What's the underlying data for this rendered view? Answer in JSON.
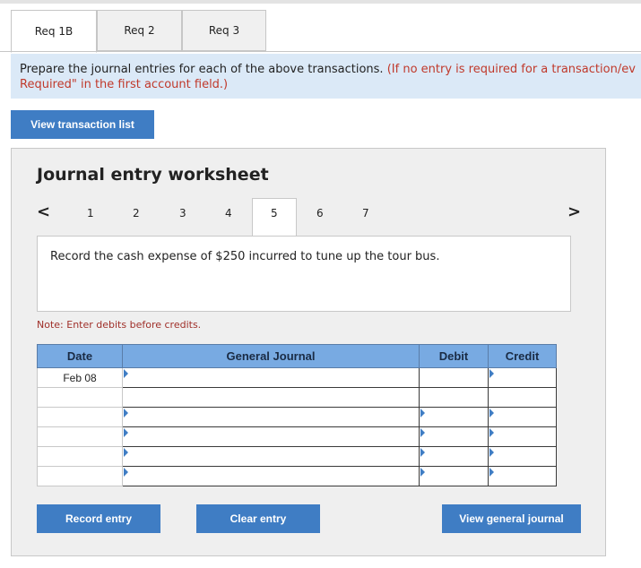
{
  "tabs": [
    {
      "label": "Req 1B",
      "active": true
    },
    {
      "label": "Req 2",
      "active": false
    },
    {
      "label": "Req 3",
      "active": false
    }
  ],
  "instructions": {
    "main": "Prepare the journal entries for each of the above transactions.",
    "note_line1": "(If no entry is required for a transaction/ev",
    "note_line2": "Required\" in the first account field.)"
  },
  "view_transactions_label": "View transaction list",
  "worksheet": {
    "title": "Journal entry worksheet",
    "steps": [
      "1",
      "2",
      "3",
      "4",
      "5",
      "6",
      "7"
    ],
    "active_step": "5",
    "prev_icon": "<",
    "next_icon": ">",
    "description": "Record the cash expense of $250 incurred to tune up the tour bus.",
    "note": "Note: Enter debits before credits.",
    "columns": {
      "date": "Date",
      "account": "General Journal",
      "debit": "Debit",
      "credit": "Credit"
    },
    "rows": [
      {
        "date": "Feb 08",
        "account": "",
        "debit": "",
        "credit": ""
      },
      {
        "date": "",
        "account": "",
        "debit": "",
        "credit": ""
      },
      {
        "date": "",
        "account": "",
        "debit": "",
        "credit": ""
      },
      {
        "date": "",
        "account": "",
        "debit": "",
        "credit": ""
      },
      {
        "date": "",
        "account": "",
        "debit": "",
        "credit": ""
      },
      {
        "date": "",
        "account": "",
        "debit": "",
        "credit": ""
      }
    ],
    "record_label": "Record entry",
    "clear_label": "Clear entry",
    "view_journal_label": "View general journal"
  },
  "colors": {
    "button": "#3f7dc4",
    "header": "#78aae2",
    "instruction_bg": "#dbe9f7",
    "note_red": "#c0392b"
  }
}
